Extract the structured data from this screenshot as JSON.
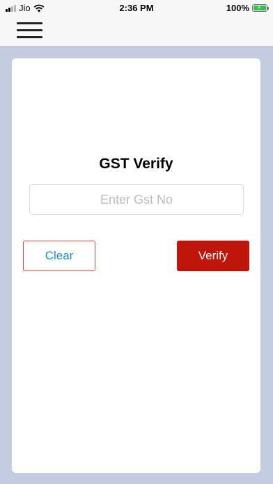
{
  "status_bar": {
    "carrier": "Jio",
    "time": "2:36 PM",
    "battery": "100%",
    "icons": [
      "signal-icon",
      "wifi-icon",
      "battery-charging-icon"
    ]
  },
  "nav": {
    "icons": [
      "hamburger-menu-icon"
    ]
  },
  "form": {
    "title": "GST Verify",
    "gst_placeholder": "Enter Gst No",
    "gst_value": "",
    "clear_label": "Clear",
    "verify_label": "Verify"
  },
  "colors": {
    "background": "#c3cce0",
    "clear_border": "#d9493a",
    "clear_text": "#1a8ed8",
    "verify_bg": "#c0150b"
  }
}
